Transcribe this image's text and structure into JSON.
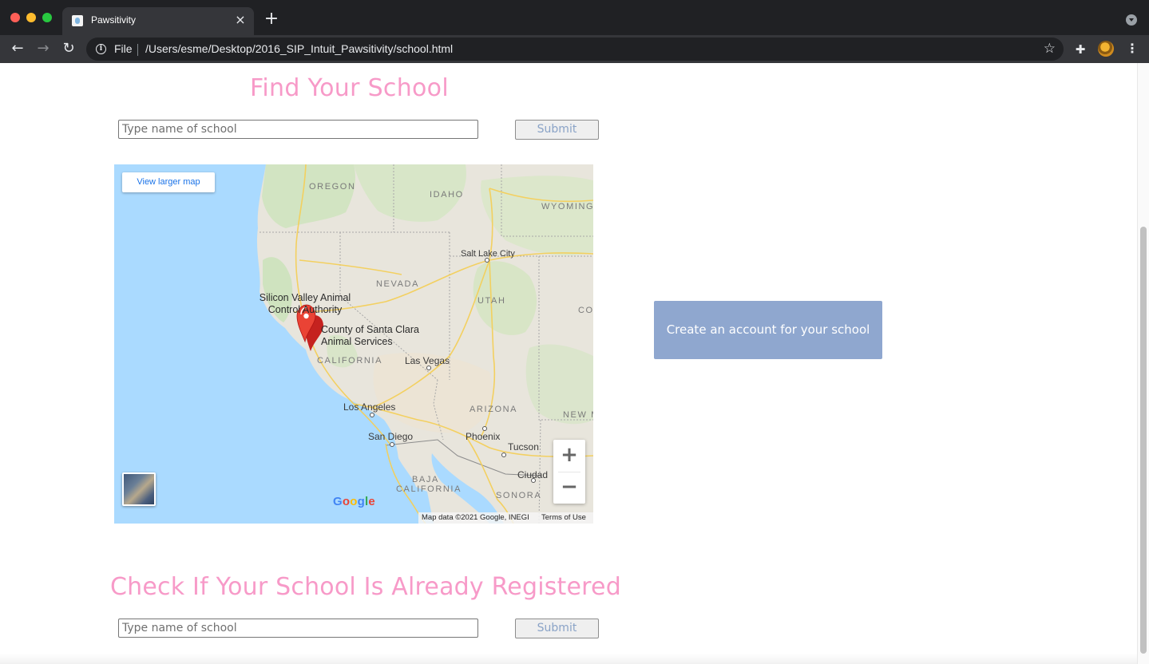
{
  "browser": {
    "tab_title": "Pawsitivity",
    "tab_close": "×",
    "new_tab": "+",
    "address_scheme": "File",
    "address_url": "/Users/esme/Desktop/2016_SIP_Intuit_Pawsitivity/school.html"
  },
  "find_section": {
    "heading": "Find Your School",
    "input_placeholder": "Type name of school",
    "submit_label": "Submit"
  },
  "map": {
    "view_larger": "View larger map",
    "states": [
      "OREGON",
      "IDAHO",
      "WYOMING",
      "NEVADA",
      "UTAH",
      "CO",
      "CALIFORNIA",
      "ARIZONA",
      "NEW M",
      "BAJA",
      "CALIFORNIA",
      "SONORA"
    ],
    "cities": [
      "Salt Lake City",
      "Las Vegas",
      "Los Angeles",
      "San Diego",
      "Phoenix",
      "Tucson",
      "Ciudad"
    ],
    "marker_1": "Silicon Valley Animal Control Authority",
    "marker_2": "County of Santa Clara Animal Services",
    "zoom_in": "+",
    "zoom_out": "−",
    "logo": [
      "G",
      "o",
      "o",
      "g",
      "l",
      "e"
    ],
    "attribution": "Map data ©2021 Google, INEGI",
    "terms": "Terms of Use",
    "colors": {
      "ocean": "#aadaff",
      "land": "#e8e5dc",
      "forest": "#cfe3bf",
      "highway": "#f9d96b",
      "marker": "#ea4335"
    }
  },
  "create_account": {
    "label": "Create an account for your school"
  },
  "check_section": {
    "heading": "Check If Your School Is Already Registered",
    "input_placeholder": "Type name of school",
    "submit_label": "Submit"
  },
  "colors": {
    "heading_pink": "#f79ac8",
    "button_blue": "#8fa7cf"
  }
}
